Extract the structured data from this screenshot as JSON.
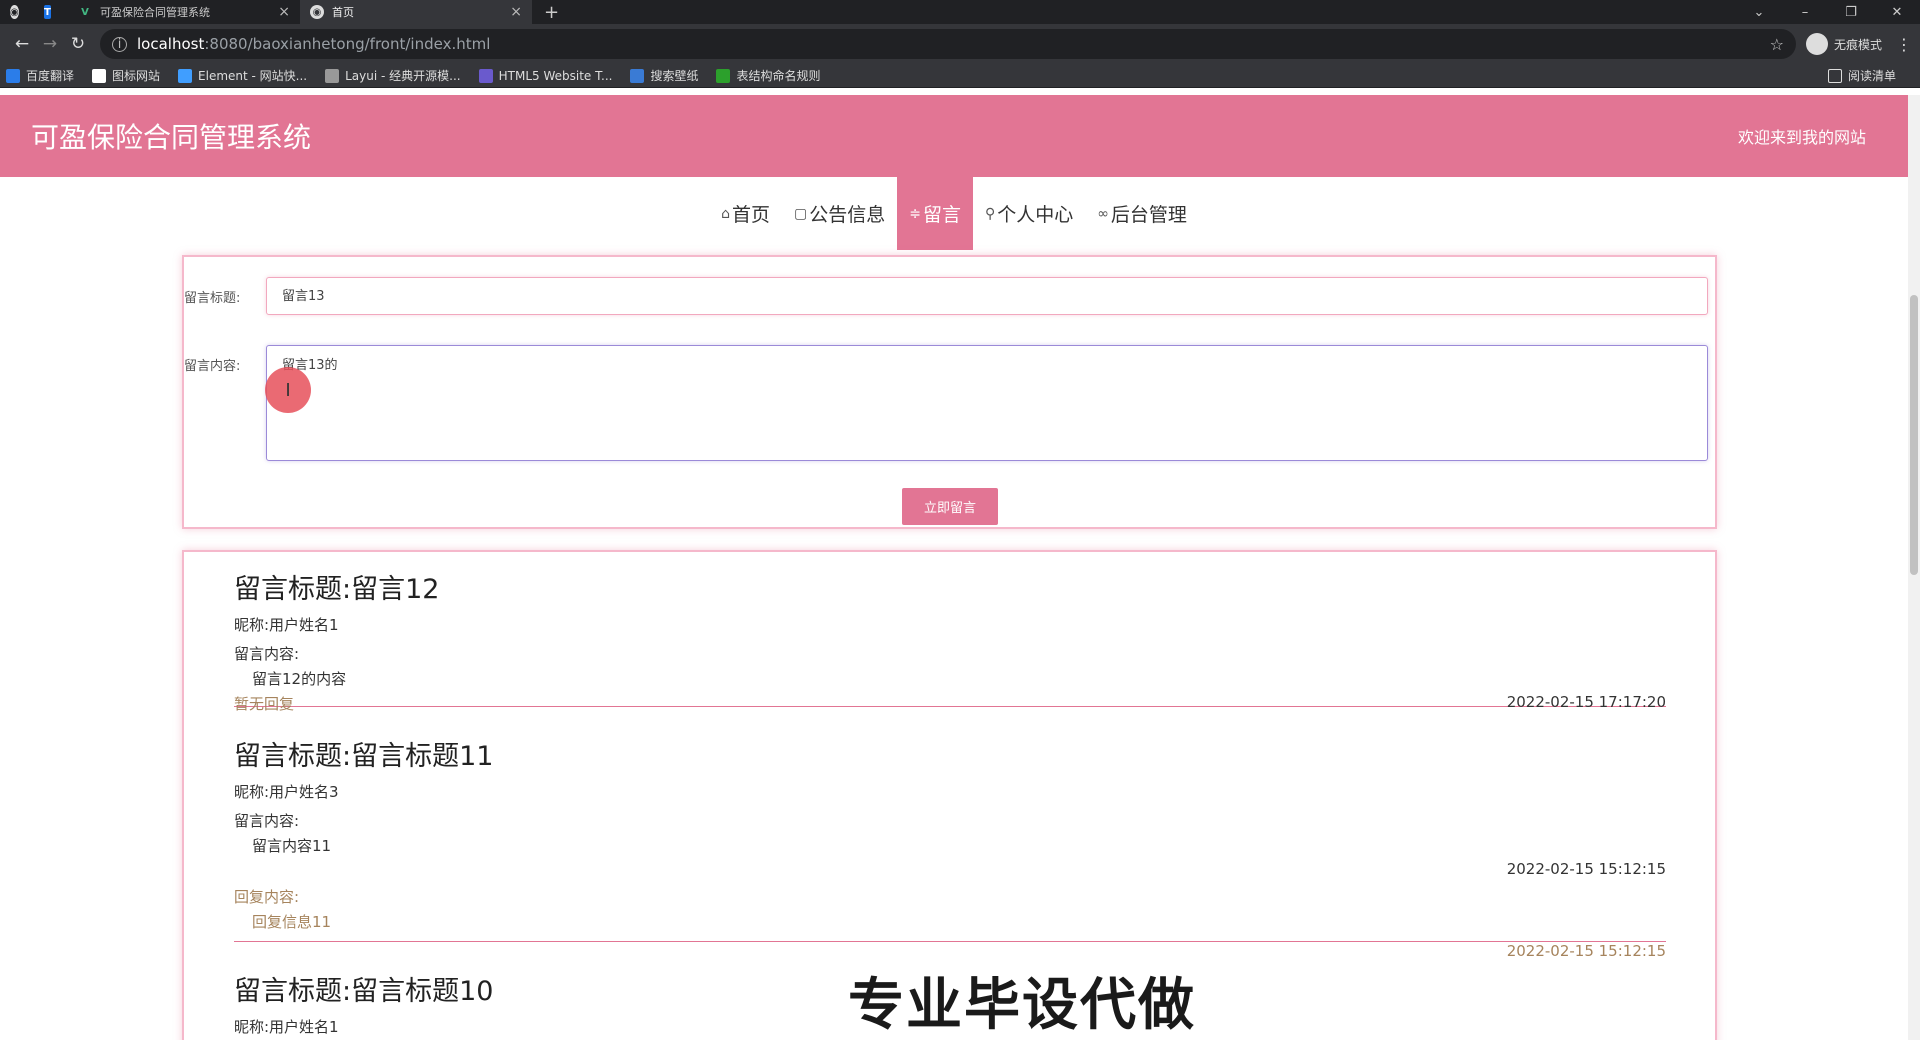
{
  "browser": {
    "tabs": [
      {
        "label": ""
      },
      {
        "label": ""
      },
      {
        "label": "可盈保险合同管理系统"
      },
      {
        "label": "首页"
      }
    ],
    "url_host": "localhost",
    "url_path": ":8080/baoxianhetong/front/index.html",
    "incognito_label": "无痕模式",
    "bookmarks": [
      {
        "label": "百度翻译",
        "color": "#2b7de9"
      },
      {
        "label": "图标网站",
        "color": "#ffffff"
      },
      {
        "label": "Element - 网站快...",
        "color": "#409eff"
      },
      {
        "label": "Layui - 经典开源模...",
        "color": "#999999"
      },
      {
        "label": "HTML5 Website T...",
        "color": "#6a5acd"
      },
      {
        "label": "搜索壁纸",
        "color": "#3a7bd5"
      },
      {
        "label": "表结构命名规则",
        "color": "#2ca02c"
      }
    ],
    "reading_list": "阅读清单"
  },
  "header": {
    "title": "可盈保险合同管理系统",
    "welcome": "欢迎来到我的网站"
  },
  "nav": [
    {
      "icon": "⌂",
      "label": "首页",
      "active": false
    },
    {
      "icon": "▢",
      "label": "公告信息",
      "active": false
    },
    {
      "icon": "≑",
      "label": "留言",
      "active": true
    },
    {
      "icon": "⚲",
      "label": "个人中心",
      "active": false
    },
    {
      "icon": "∞",
      "label": "后台管理",
      "active": false
    }
  ],
  "form": {
    "title_label": "留言标题:",
    "title_value": "留言13",
    "content_label": "留言内容:",
    "content_value": "留言13的",
    "submit_label": "立即留言"
  },
  "messages": [
    {
      "title": "留言标题:留言12",
      "nickname": "昵称:用户姓名1",
      "content_label": "留言内容:",
      "content": "留言12的内容",
      "no_reply": "暂无回复",
      "time": "2022-02-15 17:17:20"
    },
    {
      "title": "留言标题:留言标题11",
      "nickname": "昵称:用户姓名3",
      "content_label": "留言内容:",
      "content": "留言内容11",
      "time": "2022-02-15 15:12:15",
      "reply_label": "回复内容:",
      "reply": "回复信息11",
      "reply_time": "2022-02-15 15:12:15"
    },
    {
      "title": "留言标题:留言标题10",
      "nickname": "昵称:用户姓名1"
    }
  ],
  "watermark": "专业毕设代做",
  "colors": {
    "accent": "#e27594",
    "reply": "#a6845d"
  }
}
